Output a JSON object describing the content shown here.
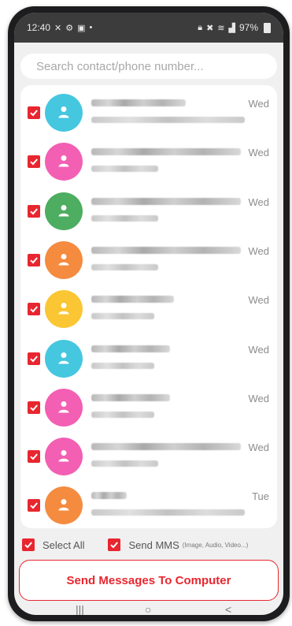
{
  "status_bar": {
    "time": "12:40",
    "battery": "97%",
    "left_icons": [
      "x-icon",
      "settings-icon",
      "image-icon",
      "dot-icon"
    ],
    "right_icons": [
      "lock-icon",
      "mute-icon",
      "wifi-icon",
      "signal-icon"
    ]
  },
  "search": {
    "placeholder": "Search contact/phone number..."
  },
  "contacts": [
    {
      "color": "#45c7e0",
      "date": "Wed",
      "checked": true
    },
    {
      "color": "#f35fb3",
      "date": "Wed",
      "checked": true
    },
    {
      "color": "#4dad61",
      "date": "Wed",
      "checked": true
    },
    {
      "color": "#f58b3f",
      "date": "Wed",
      "checked": true
    },
    {
      "color": "#fbc634",
      "date": "Wed",
      "checked": true
    },
    {
      "color": "#45c7e0",
      "date": "Wed",
      "checked": true
    },
    {
      "color": "#f35fb3",
      "date": "Wed",
      "checked": true
    },
    {
      "color": "#f35fb3",
      "date": "Wed",
      "checked": true
    },
    {
      "color": "#f58b3f",
      "date": "Tue",
      "checked": true
    }
  ],
  "options": {
    "select_all": "Select All",
    "send_mms": "Send MMS",
    "send_mms_note": "(Image, Audio, Video...)"
  },
  "send_button": "Send Messages To Computer",
  "nav": {
    "recent": "|||",
    "home": "○",
    "back": "<"
  },
  "colors": {
    "accent": "#e8262f",
    "status_bar": "#3c3c3c"
  }
}
